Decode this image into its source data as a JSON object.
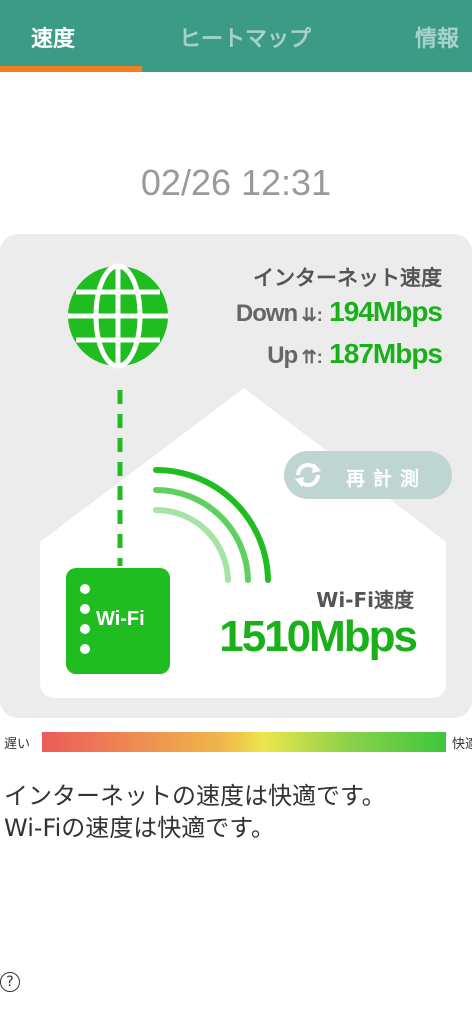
{
  "tabs": [
    {
      "label": "速度",
      "active": true
    },
    {
      "label": "ヒートマップ",
      "active": false
    },
    {
      "label": "情報",
      "active": false
    }
  ],
  "datetime": "02/26 12:31",
  "internet": {
    "title": "インターネット速度",
    "down_label": "Down",
    "down_value": "194Mbps",
    "up_label": "Up",
    "up_value": "187Mbps"
  },
  "remeasure_label": "再計測",
  "router_label": "Wi-Fi",
  "wifi": {
    "title": "Wi-Fi速度",
    "value": "1510Mbps"
  },
  "scale": {
    "slow": "遅い",
    "fast": "快適"
  },
  "message": "インターネットの速度は快適です。\nWi-Fiの速度は快適です。",
  "help_label": "?",
  "colors": {
    "header": "#3b9b85",
    "accent": "#f07f1e",
    "green": "#1fbd1f"
  }
}
